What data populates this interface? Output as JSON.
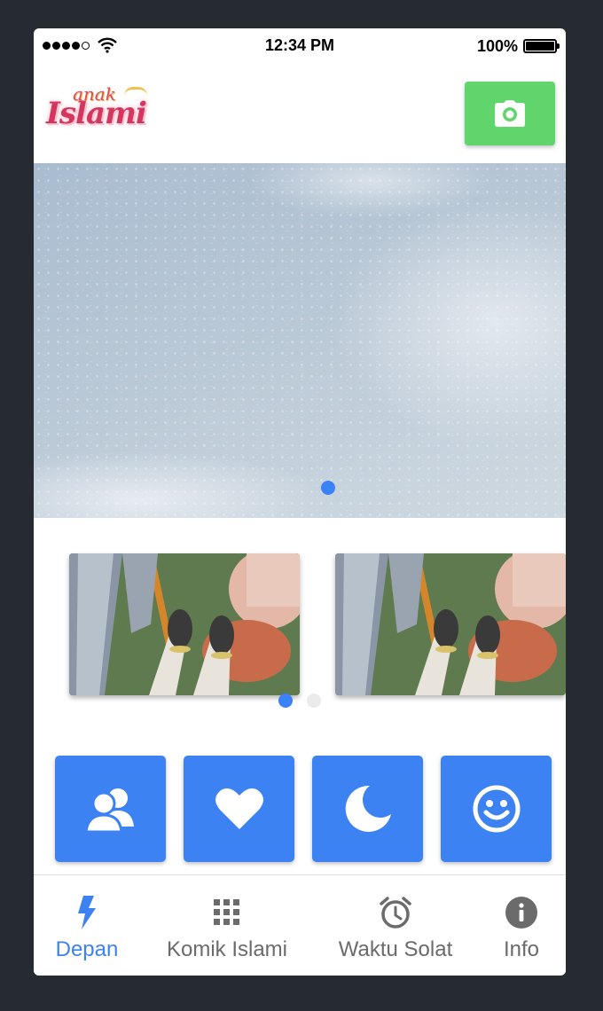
{
  "status_bar": {
    "time": "12:34 PM",
    "battery_percent": "100%",
    "signal_bars": 4,
    "signal_max": 5
  },
  "header": {
    "logo_text_top": "anak",
    "logo_text_main": "Islami",
    "camera_button_icon": "camera-icon",
    "camera_button_color": "#5fd56c"
  },
  "hero": {
    "slide_count": 1,
    "active_slide": 1
  },
  "thumbnails": {
    "items": [
      {
        "icon": "feet-over-city-image"
      },
      {
        "icon": "feet-over-city-image"
      }
    ],
    "page_count": 2,
    "active_page": 1
  },
  "tiles": [
    {
      "icon": "users-icon",
      "label": ""
    },
    {
      "icon": "heart-icon",
      "label": ""
    },
    {
      "icon": "moon-icon",
      "label": ""
    },
    {
      "icon": "smiley-icon",
      "label": ""
    }
  ],
  "tabbar": {
    "tabs": [
      {
        "label": "Depan",
        "icon": "lightning-icon",
        "active": true
      },
      {
        "label": "Komik Islami",
        "icon": "grid-icon",
        "active": false
      },
      {
        "label": "Waktu Solat",
        "icon": "alarm-clock-icon",
        "active": false
      },
      {
        "label": "Info",
        "icon": "info-icon",
        "active": false
      }
    ]
  },
  "colors": {
    "accent": "#3d82f3",
    "tile": "#3d82f3",
    "camera_button": "#5fd56c",
    "inactive_tab": "#6b6b6b",
    "background": "#262a31"
  }
}
